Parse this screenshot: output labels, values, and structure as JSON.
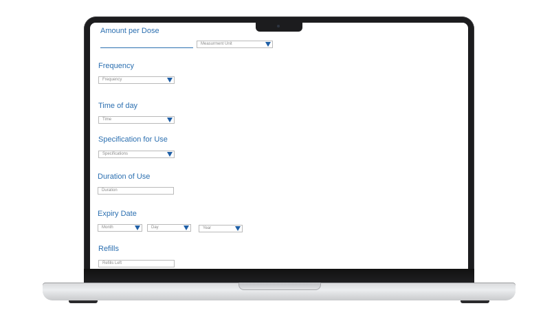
{
  "form": {
    "amount": {
      "label": "Amount per Dose",
      "unit_placeholder": "Measurment Unit"
    },
    "frequency": {
      "label": "Frequency",
      "placeholder": "Frequency"
    },
    "time": {
      "label": "Time of day",
      "placeholder": "Time"
    },
    "specification": {
      "label": "Specification for Use",
      "placeholder": "Specifications"
    },
    "duration": {
      "label": "Duration of Use",
      "placeholder": "Duration"
    },
    "expiry": {
      "label": "Expiry Date",
      "month": "Month",
      "day": "Day",
      "year": "Year"
    },
    "refills": {
      "label": "Refills",
      "placeholder": "Refills Left"
    }
  },
  "colors": {
    "label": "#2b6fb0",
    "arrow": "#1f5fa6",
    "bezel": "#1c1c1e"
  }
}
